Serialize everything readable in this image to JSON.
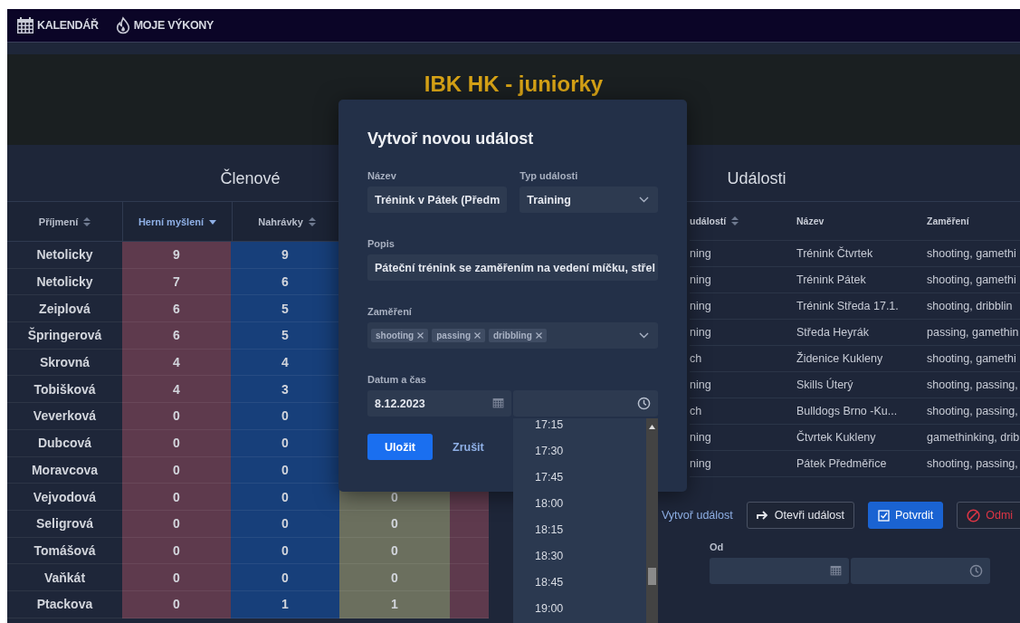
{
  "nav": [
    {
      "label": "KALENDÁŘ"
    },
    {
      "label": "MOJE VÝKONY"
    }
  ],
  "team_title": "IBK HK - juniorky",
  "members": {
    "title": "Členové",
    "columns": [
      {
        "label": "Příjmení",
        "sorted": false
      },
      {
        "label": "Herní myšlení",
        "sorted": true
      },
      {
        "label": "Nahrávky",
        "sorted": false
      }
    ],
    "rows": [
      {
        "surname": "Netolicky",
        "values": [
          "9",
          "9"
        ]
      },
      {
        "surname": "Netolicky",
        "values": [
          "7",
          "6"
        ]
      },
      {
        "surname": "Zeiplová",
        "values": [
          "6",
          "5"
        ]
      },
      {
        "surname": "Špringerová",
        "values": [
          "6",
          "5"
        ]
      },
      {
        "surname": "Skrovná",
        "values": [
          "4",
          "4"
        ]
      },
      {
        "surname": "Tobišková",
        "values": [
          "4",
          "3"
        ]
      },
      {
        "surname": "Veverková",
        "values": [
          "0",
          "0"
        ]
      },
      {
        "surname": "Dubcová",
        "values": [
          "0",
          "0"
        ]
      },
      {
        "surname": "Moravcova",
        "values": [
          "0",
          "0"
        ]
      },
      {
        "surname": "Vejvodová",
        "values": [
          "0",
          "0"
        ],
        "column_4": "0"
      },
      {
        "surname": "Seligrová",
        "values": [
          "0",
          "0"
        ],
        "column_4": "0"
      },
      {
        "surname": "Tomášová",
        "values": [
          "0",
          "0"
        ],
        "column_4": "0"
      },
      {
        "surname": "Vaňkát",
        "values": [
          "0",
          "0"
        ],
        "column_4": "0"
      },
      {
        "surname": "Ptackova",
        "values": [
          "0",
          "1"
        ],
        "column_4": "1"
      }
    ]
  },
  "events": {
    "title": "Události",
    "columns": [
      {
        "label": "událostí",
        "sortable": true
      },
      {
        "label": "Název",
        "sortable": false
      },
      {
        "label": "Zaměření",
        "sortable": false
      }
    ],
    "rows": [
      {
        "type": "ning",
        "name": "Trénink Čtvrtek",
        "focus": "shooting, gamethi"
      },
      {
        "type": "ning",
        "name": "Trénink Pátek",
        "focus": "shooting, gamethi"
      },
      {
        "type": "ning",
        "name": "Trénink Středa 17.1.",
        "focus": "shooting, dribblin"
      },
      {
        "type": "ning",
        "name": "Středa Heyrák",
        "focus": "passing, gamethin"
      },
      {
        "type": "ch",
        "name": "Židenice Kukleny",
        "focus": "shooting, gamethi"
      },
      {
        "type": "ning",
        "name": "Skills Úterý",
        "focus": "shooting, passing,"
      },
      {
        "type": "ch",
        "name": "Bulldogs Brno -Ku...",
        "focus": "shooting, passing,"
      },
      {
        "type": "ning",
        "name": "Čtvrtek Kukleny",
        "focus": "gamethinking, drib"
      },
      {
        "type": "ning",
        "name": "Pátek Předměřice",
        "focus": "shooting, passing,"
      }
    ],
    "actions": [
      {
        "kind": "link",
        "label": "Vytvoř událost"
      },
      {
        "kind": "secondary",
        "label": "Otevři událost"
      },
      {
        "kind": "primary",
        "label": "Potvrdit"
      },
      {
        "kind": "danger",
        "label": "Odmi"
      }
    ],
    "from_label": "Od"
  },
  "modal": {
    "title": "Vytvoř novou událost",
    "name_label": "Název",
    "name_value": "Trénink v Pátek (Předm",
    "type_label": "Typ události",
    "type_value": "Training",
    "description_label": "Popis",
    "description_value": "Páteční trénink se zaměřením na vedení míčku, střel",
    "focus_label": "Zaměření",
    "tags": [
      "shooting",
      "passing",
      "dribbling"
    ],
    "datetime_label": "Datum a čas",
    "date_value": "8.12.2023",
    "save": "Uložit",
    "cancel": "Zrušit"
  },
  "time_options": [
    "17:15",
    "17:30",
    "17:45",
    "18:00",
    "18:15",
    "18:30",
    "18:45",
    "19:00"
  ]
}
